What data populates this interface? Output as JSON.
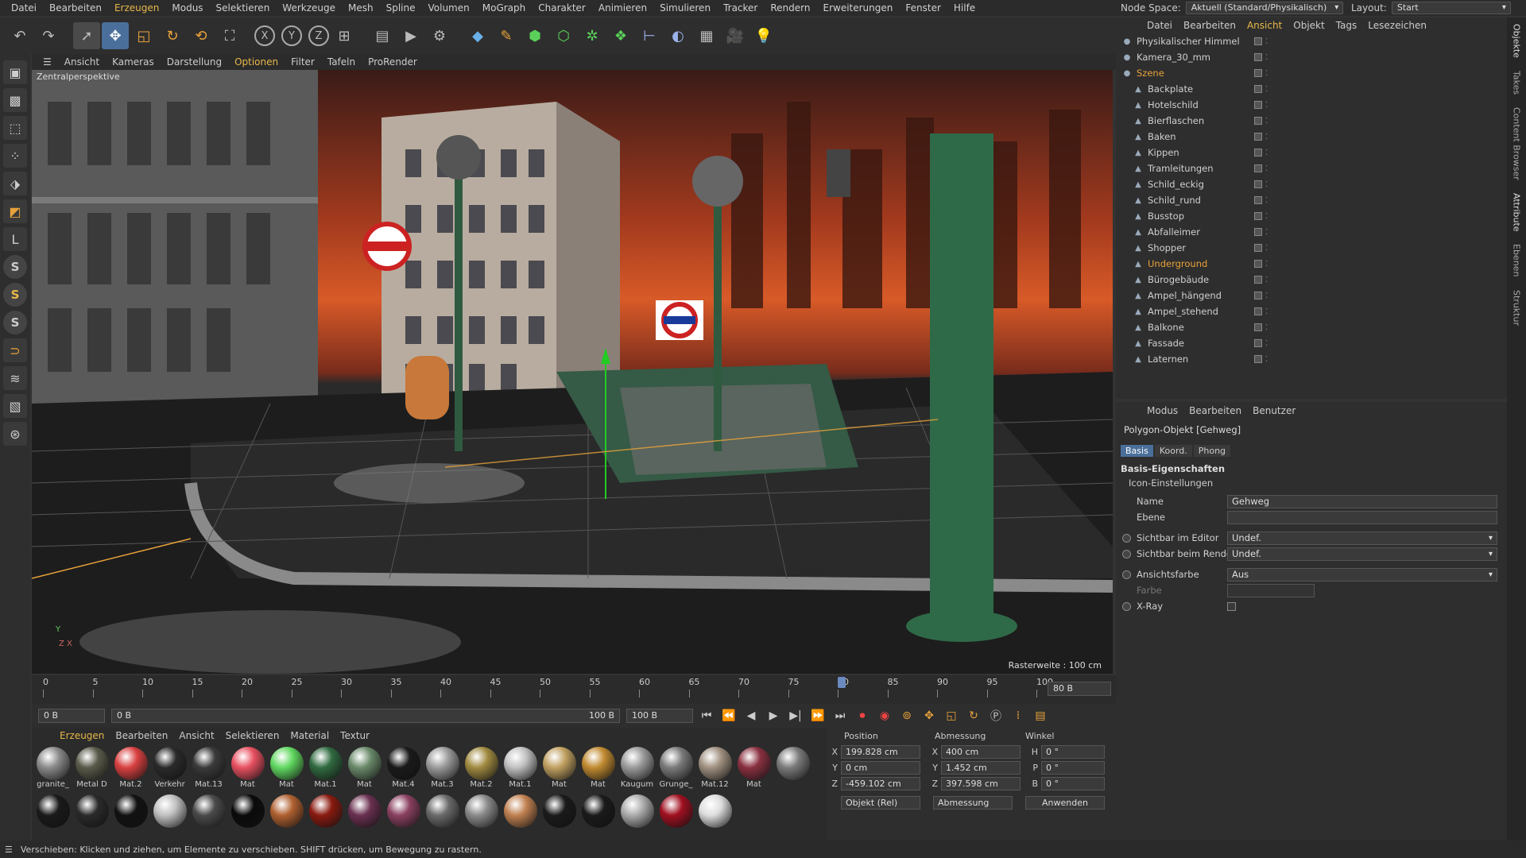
{
  "menubar": {
    "items": [
      "Datei",
      "Bearbeiten",
      "Erzeugen",
      "Modus",
      "Selektieren",
      "Werkzeuge",
      "Mesh",
      "Spline",
      "Volumen",
      "MoGraph",
      "Charakter",
      "Animieren",
      "Simulieren",
      "Tracker",
      "Rendern",
      "Erweiterungen",
      "Fenster",
      "Hilfe"
    ],
    "node_space_label": "Node Space:",
    "node_space_value": "Aktuell (Standard/Physikalisch)",
    "layout_label": "Layout:",
    "layout_value": "Start"
  },
  "viewport": {
    "menu": [
      "Ansicht",
      "Kameras",
      "Darstellung",
      "Optionen",
      "Filter",
      "Tafeln",
      "ProRender"
    ],
    "camera_label": "Zentralperspektive",
    "grid_label": "Rasterweite : 100 cm",
    "axis_y": "Y",
    "axis_zx": "Z X"
  },
  "timeline": {
    "ticks": [
      "0",
      "5",
      "10",
      "15",
      "20",
      "25",
      "30",
      "35",
      "40",
      "45",
      "50",
      "55",
      "60",
      "65",
      "70",
      "75",
      "80",
      "85",
      "90",
      "95",
      "100"
    ],
    "current_frame_field": "80 B",
    "start_field": "0 B",
    "start_field2": "0 B",
    "end_field": "100 B",
    "end_field2": "100 B"
  },
  "materials": {
    "menu": [
      "Erzeugen",
      "Bearbeiten",
      "Ansicht",
      "Selektieren",
      "Material",
      "Textur"
    ],
    "row1": [
      {
        "name": "granite_",
        "color": "#8a8a8a"
      },
      {
        "name": "Metal D",
        "color": "#5a5a4a"
      },
      {
        "name": "Mat.2",
        "color": "#d94040"
      },
      {
        "name": "Verkehr",
        "color": "#2a2a2a"
      },
      {
        "name": "Mat.13",
        "color": "#3a3a3a"
      },
      {
        "name": "Mat",
        "color": "#e85060"
      },
      {
        "name": "Mat",
        "color": "#60d860"
      },
      {
        "name": "Mat.1",
        "color": "#306a40"
      },
      {
        "name": "Mat",
        "color": "#6a8a6a"
      },
      {
        "name": "Mat.4",
        "color": "#1a1a1a"
      },
      {
        "name": "Mat.3",
        "color": "#9a9a9a"
      },
      {
        "name": "Mat.2",
        "color": "#a08a40"
      },
      {
        "name": "Mat.1",
        "color": "#c0c0c0"
      },
      {
        "name": "Mat",
        "color": "#c0a060"
      },
      {
        "name": "Mat",
        "color": "#c08a30"
      },
      {
        "name": "Kaugum",
        "color": "#9a9a9a"
      },
      {
        "name": "Grunge_",
        "color": "#7a7a7a"
      },
      {
        "name": "Mat.12",
        "color": "#a09080"
      },
      {
        "name": "Mat",
        "color": "#8a3040"
      }
    ],
    "row2_colors": [
      "#7a7a7a",
      "#1a1a1a",
      "#2a2a2a",
      "#111111",
      "#c0c0c0",
      "#4a4a4a",
      "#0a0a0a",
      "#b06030",
      "#8a1a10",
      "#6a3050",
      "#8a4060",
      "#6a6a6a",
      "#8a8a8a",
      "#c08050",
      "#1a1a1a",
      "#1a1a1a",
      "#aaaaaa",
      "#a01020",
      "#dddddd"
    ]
  },
  "coords": {
    "headers": [
      "Position",
      "Abmessung",
      "Winkel"
    ],
    "rows": [
      {
        "a": "X",
        "pos": "199.828 cm",
        "b": "X",
        "size": "400 cm",
        "c": "H",
        "angle": "0 °"
      },
      {
        "a": "Y",
        "pos": "0 cm",
        "b": "Y",
        "size": "1.452 cm",
        "c": "P",
        "angle": "0 °"
      },
      {
        "a": "Z",
        "pos": "-459.102 cm",
        "b": "Z",
        "size": "397.598 cm",
        "c": "B",
        "angle": "0 °"
      }
    ],
    "mode_select": "Objekt (Rel)",
    "size_select": "Abmessung",
    "apply_button": "Anwenden"
  },
  "objects": {
    "menu": [
      "Datei",
      "Bearbeiten",
      "Ansicht",
      "Objekt",
      "Tags",
      "Lesezeichen"
    ],
    "items": [
      {
        "name": "Physikalischer Himmel",
        "indent": 0,
        "orange": false
      },
      {
        "name": "Kamera_30_mm",
        "indent": 0,
        "orange": false
      },
      {
        "name": "Szene",
        "indent": 0,
        "orange": true
      },
      {
        "name": "Backplate",
        "indent": 1,
        "orange": false
      },
      {
        "name": "Hotelschild",
        "indent": 1,
        "orange": false
      },
      {
        "name": "Bierflaschen",
        "indent": 1,
        "orange": false
      },
      {
        "name": "Baken",
        "indent": 1,
        "orange": false
      },
      {
        "name": "Kippen",
        "indent": 1,
        "orange": false
      },
      {
        "name": "Tramleitungen",
        "indent": 1,
        "orange": false
      },
      {
        "name": "Schild_eckig",
        "indent": 1,
        "orange": false
      },
      {
        "name": "Schild_rund",
        "indent": 1,
        "orange": false
      },
      {
        "name": "Busstop",
        "indent": 1,
        "orange": false
      },
      {
        "name": "Abfalleimer",
        "indent": 1,
        "orange": false
      },
      {
        "name": "Shopper",
        "indent": 1,
        "orange": false
      },
      {
        "name": "Underground",
        "indent": 1,
        "orange": true
      },
      {
        "name": "Bürogebäude",
        "indent": 1,
        "orange": false
      },
      {
        "name": "Ampel_hängend",
        "indent": 1,
        "orange": false
      },
      {
        "name": "Ampel_stehend",
        "indent": 1,
        "orange": false
      },
      {
        "name": "Balkone",
        "indent": 1,
        "orange": false
      },
      {
        "name": "Fassade",
        "indent": 1,
        "orange": false
      },
      {
        "name": "Laternen",
        "indent": 1,
        "orange": false
      }
    ]
  },
  "attributes": {
    "menu": [
      "Modus",
      "Bearbeiten",
      "Benutzer"
    ],
    "object_title": "Polygon-Objekt [Gehweg]",
    "tabs": [
      "Basis",
      "Koord.",
      "Phong"
    ],
    "section": "Basis-Eigenschaften",
    "subsection": "Icon-Einstellungen",
    "name_label": "Name",
    "name_value": "Gehweg",
    "layer_label": "Ebene",
    "vis_editor_label": "Sichtbar im Editor",
    "vis_editor_value": "Undef.",
    "vis_render_label": "Sichtbar beim Rendern",
    "vis_render_value": "Undef.",
    "viewcolor_label": "Ansichtsfarbe",
    "viewcolor_value": "Aus",
    "color_label": "Farbe",
    "xray_label": "X-Ray"
  },
  "right_tabs": [
    "Objekte",
    "Takes",
    "Content Browser",
    "Attribute",
    "Ebenen",
    "Struktur"
  ],
  "status": "Verschieben: Klicken und ziehen, um Elemente zu verschieben. SHIFT drücken, um Bewegung zu rastern."
}
